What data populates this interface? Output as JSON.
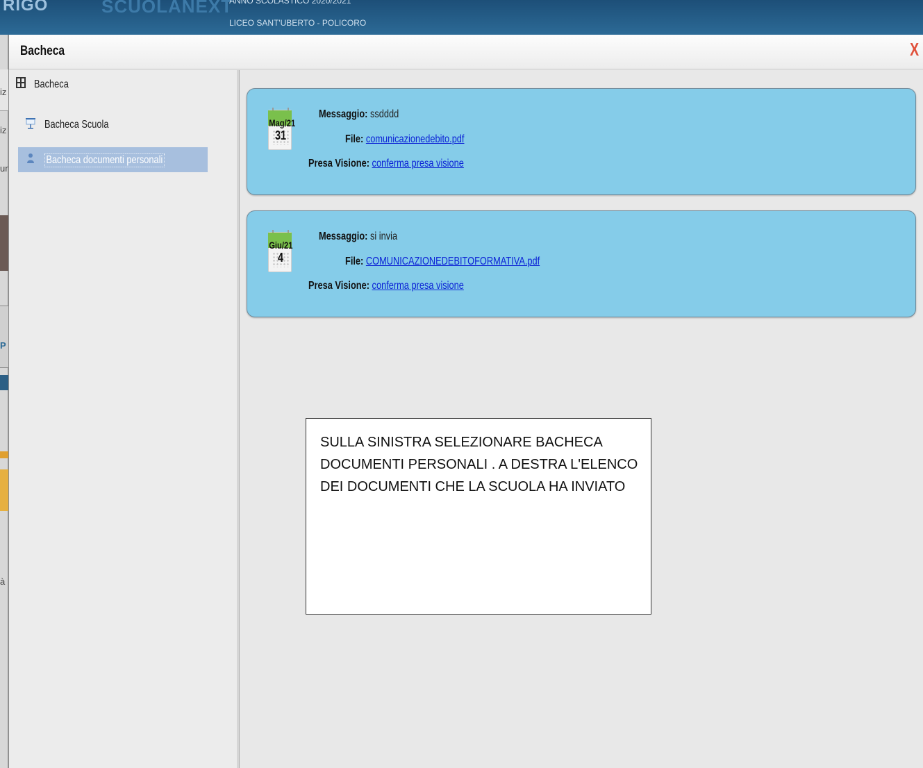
{
  "background": {
    "logo_left": "RIGO",
    "logo_right": "SCUOLANEXT",
    "header_line1": "ANNO SCOLASTICO 2020/2021",
    "header_line2": "LICEO SANT'UBERTO - POLICORO",
    "left_strip_fragments": [
      "iz",
      "iz",
      "un",
      "P",
      "à"
    ]
  },
  "modal": {
    "title": "Bacheca",
    "close_glyph": "X"
  },
  "sidebar": {
    "root_label": "Bacheca",
    "items": [
      {
        "label": "Bacheca Scuola",
        "icon": "presentation-board-icon",
        "selected": false
      },
      {
        "label": "Bacheca documenti personali",
        "icon": "user-document-icon",
        "selected": true
      }
    ]
  },
  "messages": [
    {
      "month": "Mag/21",
      "day": "31",
      "message_label": "Messaggio:",
      "message": "ssdddd",
      "file_label": "File:",
      "file": "comunicazionedebito.pdf",
      "ack_label": "Presa Visione:",
      "ack": "conferma presa visione"
    },
    {
      "month": "Giu/21",
      "day": "4",
      "message_label": "Messaggio:",
      "message": "si invia",
      "file_label": "File:",
      "file": "COMUNICAZIONEDEBITOFORMATIVA.pdf",
      "ack_label": "Presa Visione:",
      "ack": "conferma presa visione"
    }
  ],
  "note": {
    "text": "SULLA SINISTRA SELEZIONARE BACHECA DOCUMENTI PERSONALI . A DESTRA L'ELENCO DEI DOCUMENTI CHE LA SCUOLA HA INVIATO"
  },
  "colors": {
    "card_bg": "#85cce9",
    "selected_item_bg": "#a7bfde",
    "calendar_green": "#7ac04c",
    "link": "#0b22d6",
    "close_x": "#e0503a"
  }
}
